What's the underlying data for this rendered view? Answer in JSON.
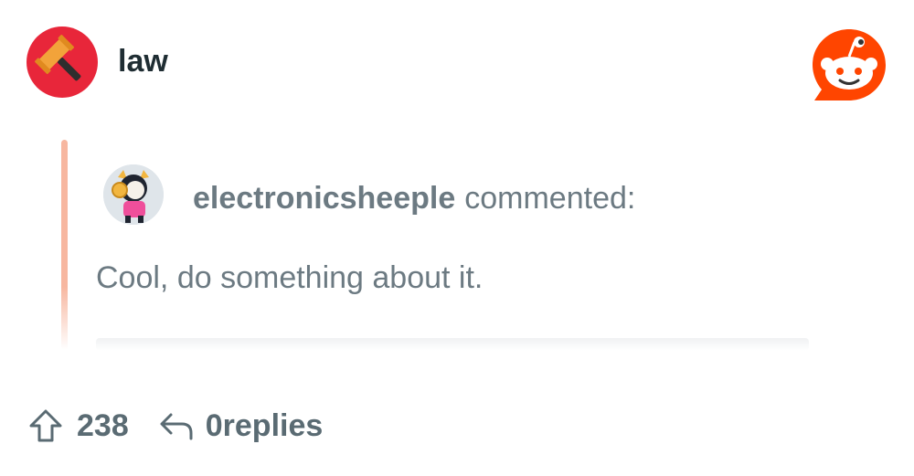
{
  "header": {
    "subreddit_name": "law",
    "subreddit_icon": "gavel-icon",
    "app_logo": "reddit-logo-icon"
  },
  "comment": {
    "username": "electronicsheeple",
    "action_text": "commented:",
    "body": "Cool, do something about it.",
    "avatar": "user-avatar"
  },
  "footer": {
    "upvote_icon": "upvote-arrow-icon",
    "vote_count": "238",
    "reply_icon": "reply-arrow-icon",
    "reply_count": "0",
    "reply_label": "replies"
  },
  "colors": {
    "subreddit_bg": "#e8263a",
    "reddit_orange": "#ff4500",
    "quote_bar": "#f7b7a0",
    "text_gray": "#6c7a82",
    "footer_text": "#5a6b73",
    "title_text": "#1f2d33"
  }
}
